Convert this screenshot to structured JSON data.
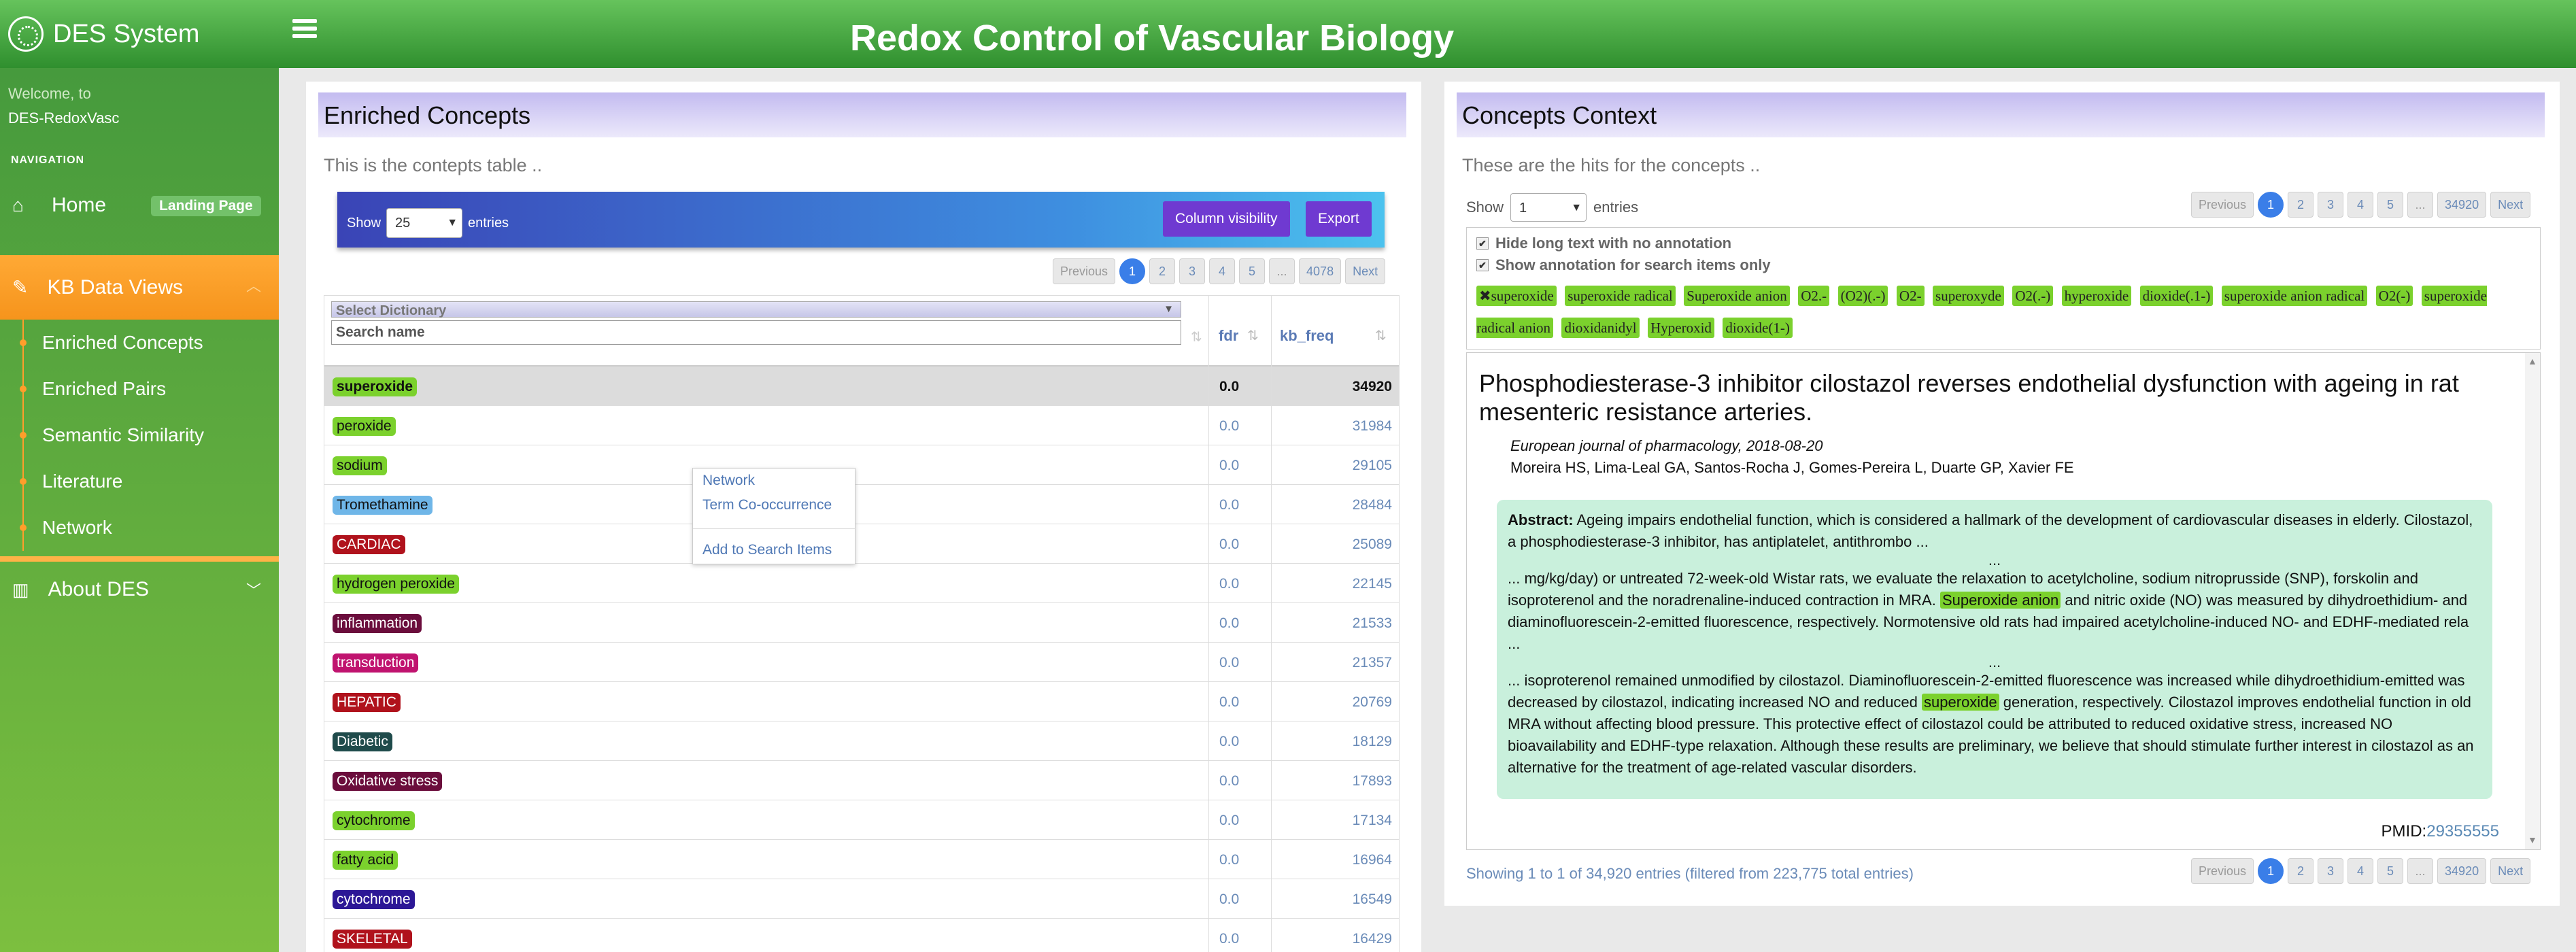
{
  "app": {
    "name": "DES System",
    "page_title": "Redox Control of Vascular Biology"
  },
  "sidebar": {
    "welcome_line1": "Welcome, to",
    "welcome_line2": "DES-RedoxVasc",
    "nav_header": "NAVIGATION",
    "home_label": "Home",
    "landing_badge": "Landing Page",
    "kb_label": "KB Data Views",
    "sub_items": [
      "Enriched Concepts",
      "Enriched Pairs",
      "Semantic Similarity",
      "Literature",
      "Network"
    ],
    "about_label": "About DES"
  },
  "left": {
    "title": "Enriched Concepts",
    "subtitle": "This is the contepts table ..",
    "show_label": "Show",
    "entries_label": "entries",
    "page_size": "25",
    "column_visibility": "Column visibility",
    "export": "Export",
    "pager": [
      "Previous",
      "1",
      "2",
      "3",
      "4",
      "5",
      "...",
      "4078",
      "Next"
    ],
    "select_dictionary": "Select Dictionary",
    "search_placeholder": "Search name",
    "col_fdr": "fdr",
    "col_kbfreq": "kb_freq",
    "rows": [
      {
        "name": "superoxide",
        "color": "#7bd12d",
        "text_color": "#111",
        "fdr": "0.0",
        "freq": "34920"
      },
      {
        "name": "peroxide",
        "color": "#7bd12d",
        "text_color": "#111",
        "fdr": "0.0",
        "freq": "31984"
      },
      {
        "name": "sodium",
        "color": "#7bd12d",
        "text_color": "#111",
        "fdr": "0.0",
        "freq": "29105"
      },
      {
        "name": "Tromethamine",
        "color": "#6fb6e8",
        "text_color": "#111",
        "fdr": "0.0",
        "freq": "28484"
      },
      {
        "name": "CARDIAC",
        "color": "#b0121c",
        "text_color": "#fff",
        "fdr": "0.0",
        "freq": "25089"
      },
      {
        "name": "hydrogen peroxide",
        "color": "#7bd12d",
        "text_color": "#111",
        "fdr": "0.0",
        "freq": "22145"
      },
      {
        "name": "inflammation",
        "color": "#6b0d3c",
        "text_color": "#fff",
        "fdr": "0.0",
        "freq": "21533"
      },
      {
        "name": "transduction",
        "color": "#c0136f",
        "text_color": "#fff",
        "fdr": "0.0",
        "freq": "21357"
      },
      {
        "name": "HEPATIC",
        "color": "#b0121c",
        "text_color": "#fff",
        "fdr": "0.0",
        "freq": "20769"
      },
      {
        "name": "Diabetic",
        "color": "#1f4b4b",
        "text_color": "#fff",
        "fdr": "0.0",
        "freq": "18129"
      },
      {
        "name": "Oxidative stress",
        "color": "#6b0d3c",
        "text_color": "#fff",
        "fdr": "0.0",
        "freq": "17893"
      },
      {
        "name": "cytochrome",
        "color": "#7bd12d",
        "text_color": "#111",
        "fdr": "0.0",
        "freq": "17134"
      },
      {
        "name": "fatty acid",
        "color": "#7bd12d",
        "text_color": "#111",
        "fdr": "0.0",
        "freq": "16964"
      },
      {
        "name": "cytochrome",
        "color": "#2c1796",
        "text_color": "#fff",
        "fdr": "0.0",
        "freq": "16549"
      },
      {
        "name": "SKELETAL",
        "color": "#b0121c",
        "text_color": "#fff",
        "fdr": "0.0",
        "freq": "16429"
      }
    ],
    "context_menu": [
      "Network",
      "Term Co-occurrence",
      "Add to Search Items"
    ]
  },
  "right": {
    "title": "Concepts Context",
    "subtitle": "These are the hits for the concepts ..",
    "show_label": "Show",
    "entries_label": "entries",
    "page_size": "1",
    "pager": [
      "Previous",
      "1",
      "2",
      "3",
      "4",
      "5",
      "...",
      "34920",
      "Next"
    ],
    "check_hide": "Hide long text with no annotation",
    "check_show": "Show annotation for search items only",
    "chips": [
      "✖superoxide",
      "superoxide radical",
      "Superoxide anion",
      "O2.-",
      "(O2)(.-)",
      "O2-",
      "superoxyde",
      "O2(.-)",
      "hyperoxide",
      "dioxide(.1-)",
      "superoxide anion radical",
      "O2(-)",
      "superoxide radical anion",
      "dioxidanidyl",
      "Hyperoxid",
      "dioxide(1-)"
    ],
    "article_title": "Phosphodiesterase-3 inhibitor cilostazol reverses endothelial dysfunction with ageing in rat mesenteric resistance arteries.",
    "journal": "European journal of pharmacology,",
    "date": "2018-08-20",
    "authors": "Moreira HS, Lima-Leal GA, Santos-Rocha J, Gomes-Pereira L, Duarte GP, Xavier FE",
    "abstract_label": "Abstract:",
    "abstract_p1": "Ageing impairs endothelial function, which is considered a hallmark of the development of cardiovascular diseases in elderly. Cilostazol, a phosphodiesterase-3 inhibitor, has antiplatelet, antithrombo ...",
    "ellipsis": "...",
    "abstract_p2_a": "... mg/kg/day) or untreated 72-week-old Wistar rats, we evaluate the relaxation to acetylcholine, sodium nitroprusside (SNP), forskolin and isoproterenol and the noradrenaline-induced contraction in MRA.",
    "abstract_p2_mark": "Superoxide anion",
    "abstract_p2_b": "and nitric oxide (NO) was measured by dihydroethidium- and diaminofluorescein-2-emitted fluorescence, respectively. Normotensive old rats had impaired acetylcholine-induced NO- and EDHF-mediated rela ...",
    "abstract_p3_a": "... isoproterenol remained unmodified by cilostazol. Diaminofluorescein-2-emitted fluorescence was increased while dihydroethidium-emitted was decreased by cilostazol, indicating increased NO and reduced",
    "abstract_p3_mark": "superoxide",
    "abstract_p3_b": "generation, respectively. Cilostazol improves endothelial function in old MRA without affecting blood pressure. This protective effect of cilostazol could be attributed to reduced oxidative stress, increased NO bioavailability and EDHF-type relaxation. Although these results are preliminary, we believe that should stimulate further interest in cilostazol as an alternative for the treatment of age-related vascular disorders.",
    "pmid_label": "PMID:",
    "pmid": "29355555",
    "footer": "Showing 1 to 1 of 34,920 entries (filtered from 223,775 total entries)"
  }
}
